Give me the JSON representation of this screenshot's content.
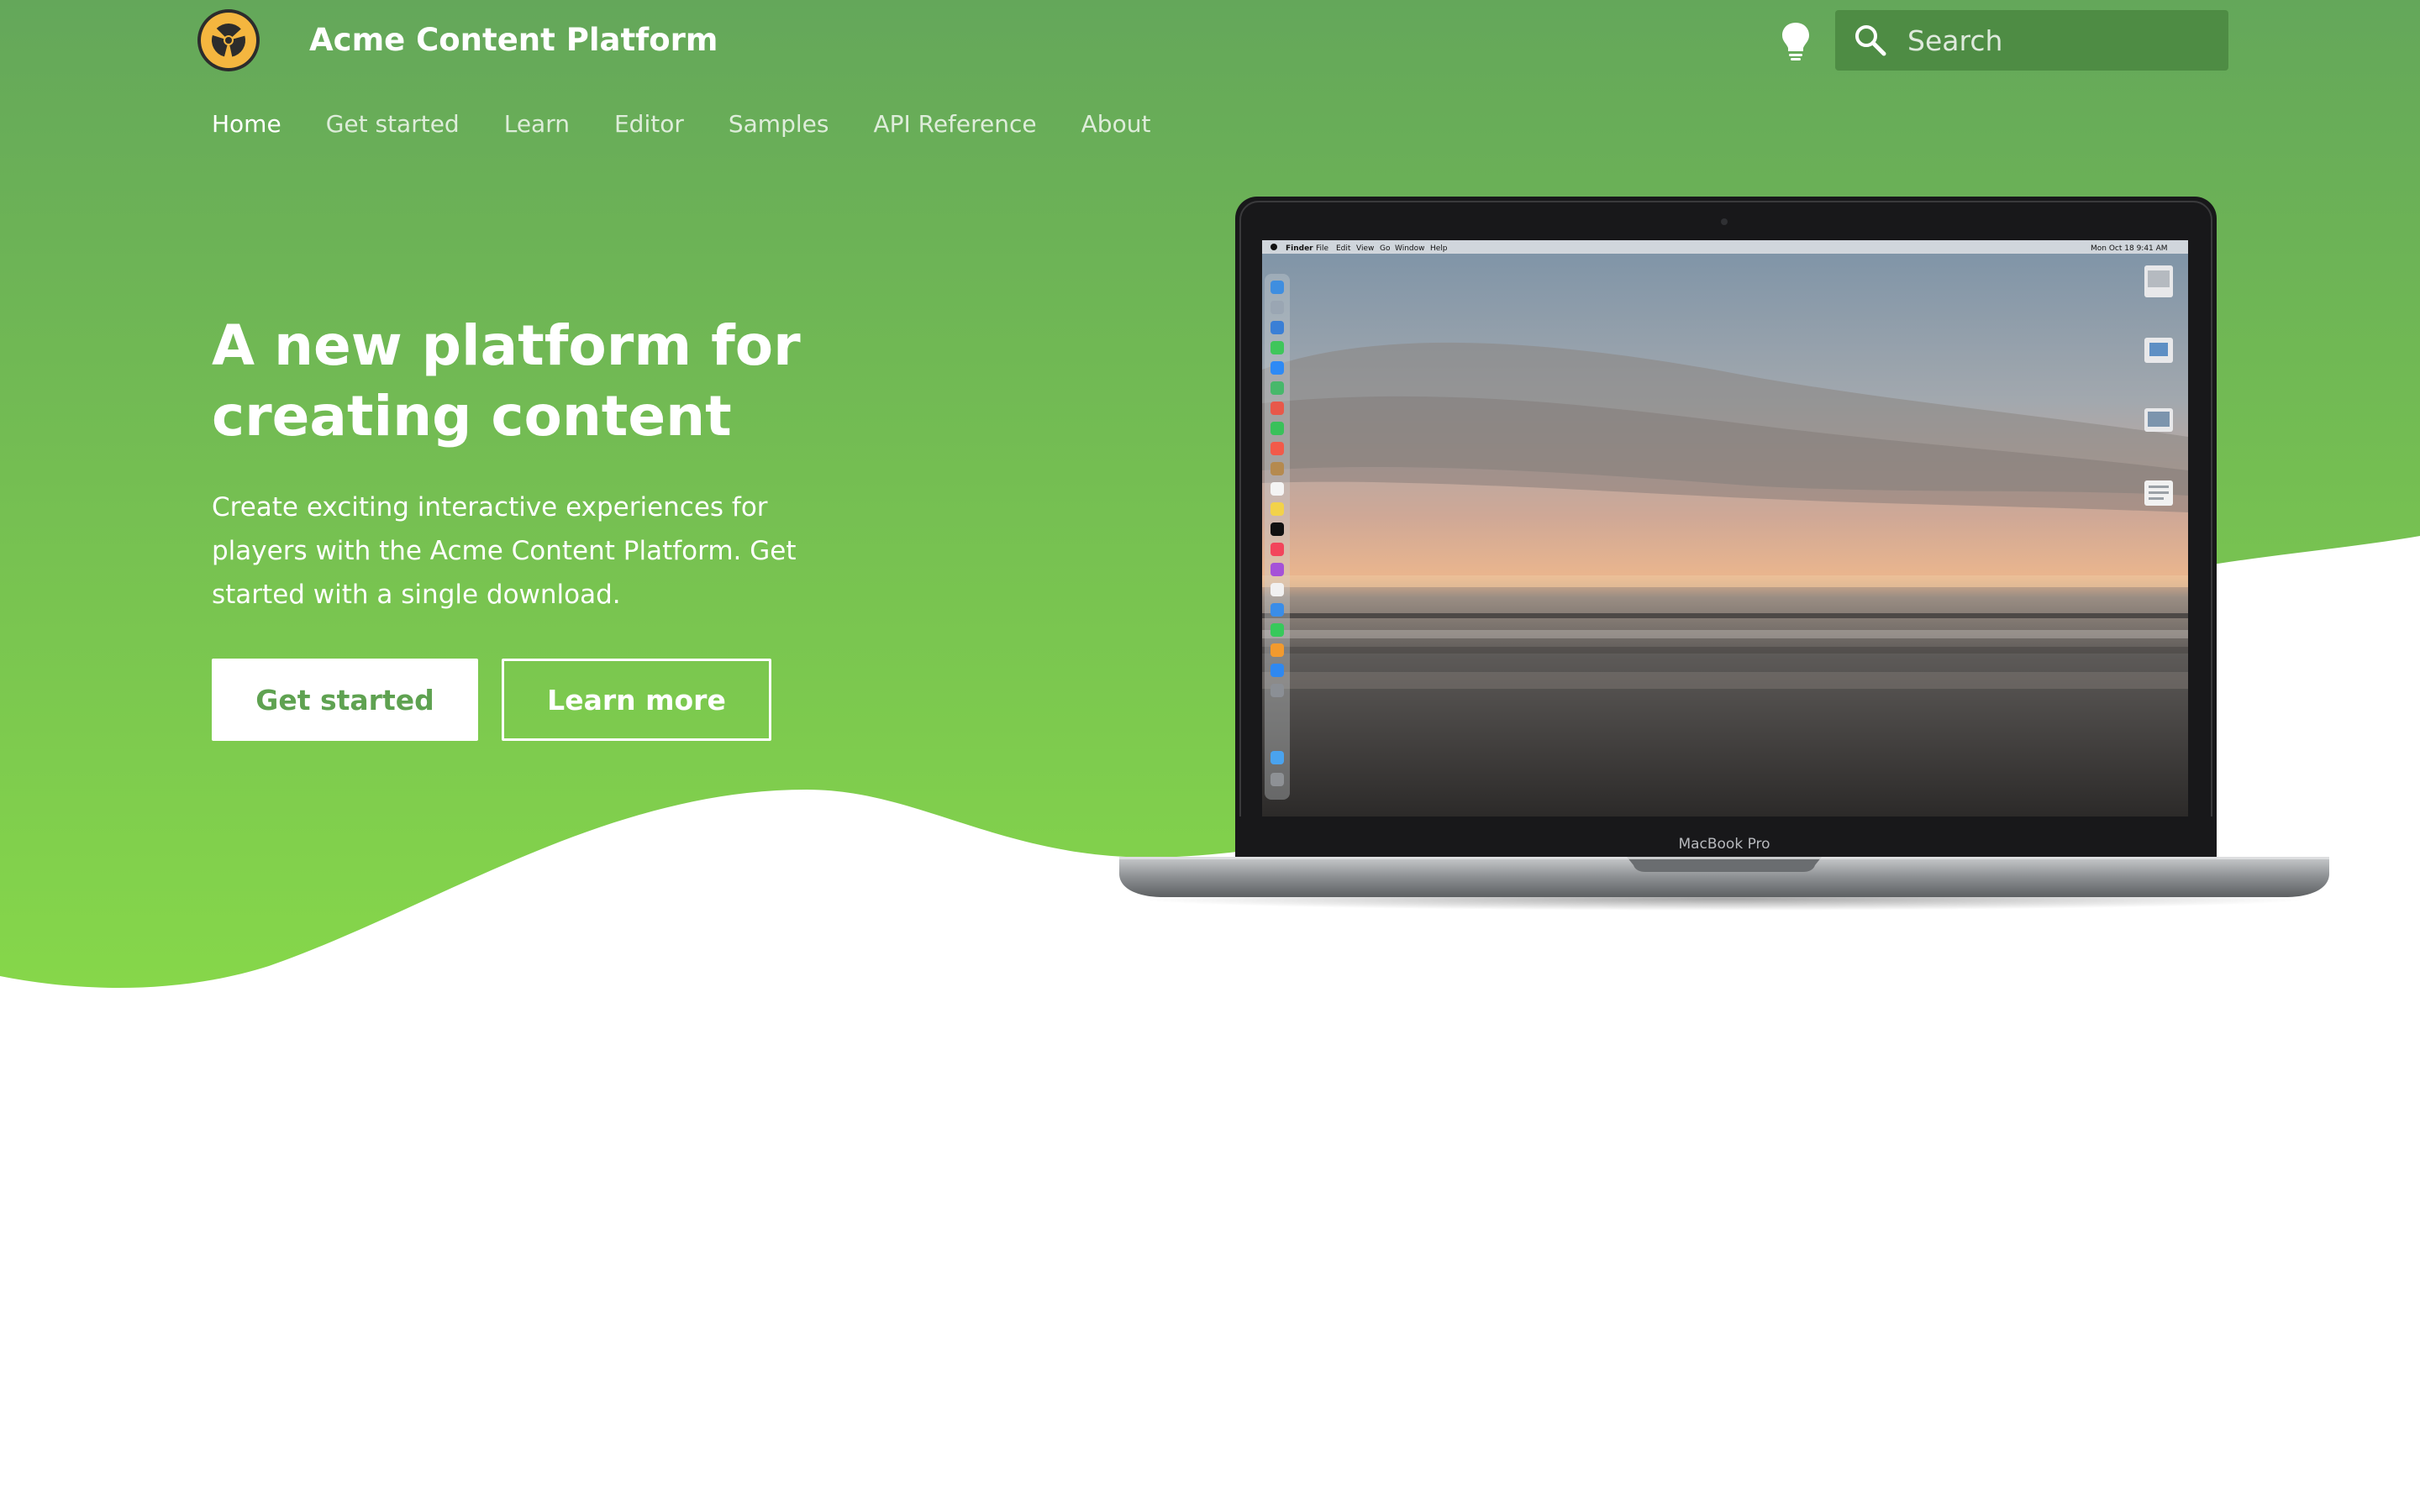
{
  "app": {
    "title": "Acme Content Platform"
  },
  "search": {
    "placeholder": "Search"
  },
  "nav": {
    "items": [
      {
        "label": "Home",
        "active": true
      },
      {
        "label": "Get started",
        "active": false
      },
      {
        "label": "Learn",
        "active": false
      },
      {
        "label": "Editor",
        "active": false
      },
      {
        "label": "Samples",
        "active": false
      },
      {
        "label": "API Reference",
        "active": false
      },
      {
        "label": "About",
        "active": false
      }
    ]
  },
  "hero": {
    "title_line1": "A new platform for",
    "title_line2": "creating content",
    "description": "Create exciting interactive experiences for players with the Acme Content Platform. Get started with a single download.",
    "primary_button": "Get started",
    "secondary_button": "Learn more"
  },
  "laptop": {
    "model_label": "MacBook Pro",
    "menubar": {
      "app": "Finder",
      "menus": [
        "File",
        "Edit",
        "View",
        "Go",
        "Window",
        "Help"
      ],
      "clock": "Mon Oct 18  9:41 AM"
    }
  },
  "colors": {
    "hero_gradient_top": "#64a75a",
    "hero_gradient_bottom": "#86d74a",
    "search_bg": "#4e8c44",
    "primary_button_text": "#5fa251",
    "logo_yellow": "#f4b63f"
  },
  "icons": {
    "logo": "radiation-logo-icon",
    "theme_toggle": "lightbulb-icon",
    "search": "search-icon"
  }
}
